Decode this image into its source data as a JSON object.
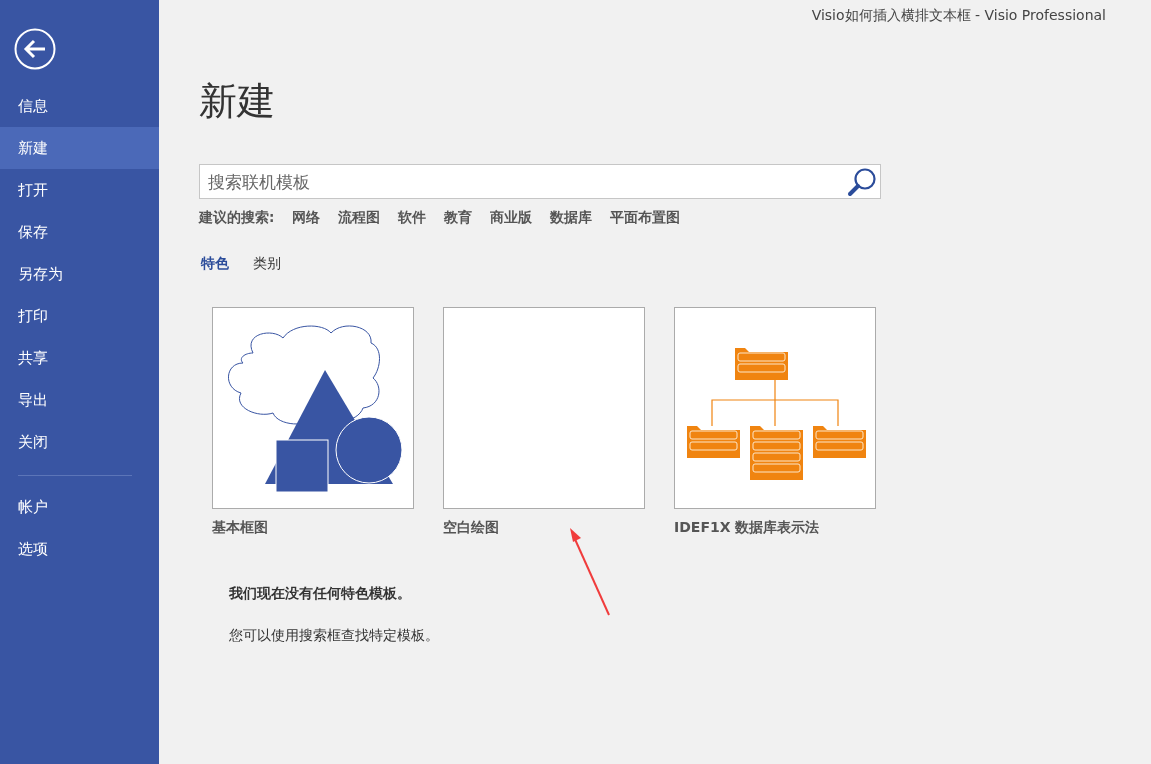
{
  "window": {
    "title": "Visio如何插入横排文本框 - Visio Professional"
  },
  "sidebar": {
    "items": [
      {
        "label": "信息",
        "selected": false
      },
      {
        "label": "新建",
        "selected": true
      },
      {
        "label": "打开",
        "selected": false
      },
      {
        "label": "保存",
        "selected": false
      },
      {
        "label": "另存为",
        "selected": false
      },
      {
        "label": "打印",
        "selected": false
      },
      {
        "label": "共享",
        "selected": false
      },
      {
        "label": "导出",
        "selected": false
      },
      {
        "label": "关闭",
        "selected": false
      }
    ],
    "bottom_items": [
      {
        "label": "帐户",
        "selected": false
      },
      {
        "label": "选项",
        "selected": false
      }
    ]
  },
  "heading": "新建",
  "search": {
    "placeholder": "搜索联机模板"
  },
  "suggested": {
    "label": "建议的搜索:",
    "items": [
      "网络",
      "流程图",
      "软件",
      "教育",
      "商业版",
      "数据库",
      "平面布置图"
    ]
  },
  "tabs": [
    {
      "label": "特色",
      "selected": true
    },
    {
      "label": "类别",
      "selected": false
    }
  ],
  "templates": [
    {
      "kind": "shapes",
      "label": "基本框图"
    },
    {
      "kind": "blank",
      "label": "空白绘图"
    },
    {
      "kind": "database",
      "label": "IDEF1X 数据库表示法"
    }
  ],
  "message": {
    "title": "我们现在没有任何特色模板。",
    "text": "您可以使用搜索框查找特定模板。"
  }
}
